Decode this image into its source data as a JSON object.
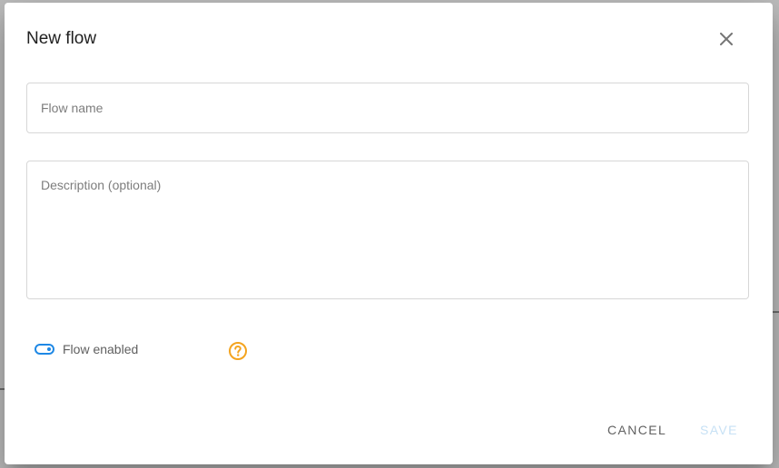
{
  "dialog": {
    "title": "New flow",
    "close_icon": "close-icon",
    "fields": {
      "name_placeholder": "Flow name",
      "name_value": "",
      "description_placeholder": "Description (optional)",
      "description_value": ""
    },
    "toggle": {
      "label": "Flow enabled",
      "enabled": true,
      "help_icon": "help-circle-icon"
    },
    "actions": {
      "cancel_label": "CANCEL",
      "save_label": "SAVE",
      "save_disabled": true
    }
  },
  "colors": {
    "accent": "#1e88e5",
    "help": "#f4a41f",
    "save_disabled": "#c7e1f5",
    "backdrop": "#bebebe"
  }
}
